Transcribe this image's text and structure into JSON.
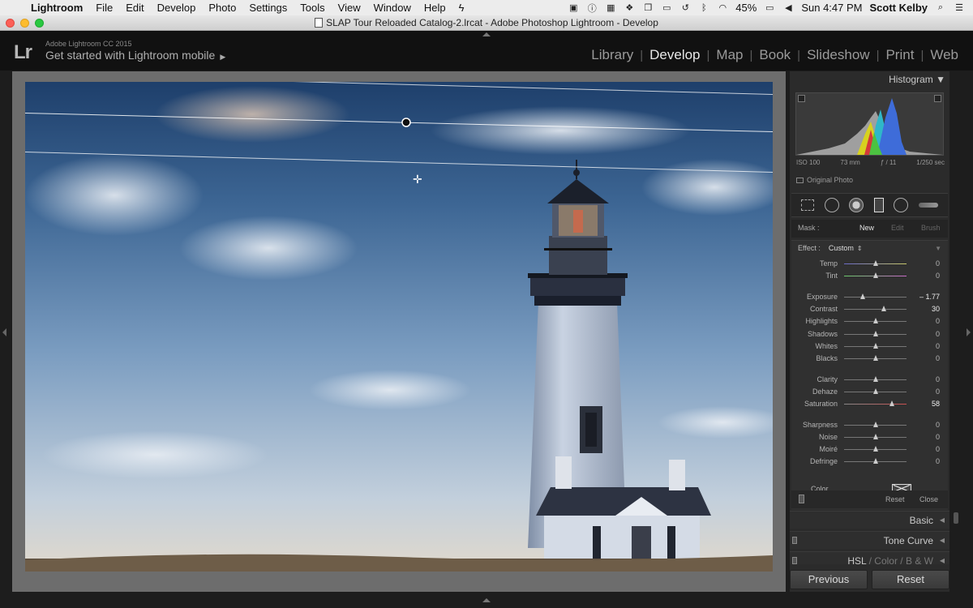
{
  "menubar": {
    "app": "Lightroom",
    "items": [
      "File",
      "Edit",
      "Develop",
      "Photo",
      "Settings",
      "Tools",
      "View",
      "Window",
      "Help"
    ],
    "battery": "45%",
    "clock": "Sun 4:47 PM",
    "user": "Scott Kelby"
  },
  "window": {
    "title": "SLAP Tour Reloaded Catalog-2.lrcat - Adobe Photoshop Lightroom - Develop"
  },
  "identity": {
    "logo": "Lr",
    "product": "Adobe Lightroom CC 2015",
    "mobile": "Get started with Lightroom mobile"
  },
  "modules": [
    "Library",
    "Develop",
    "Map",
    "Book",
    "Slideshow",
    "Print",
    "Web"
  ],
  "active_module": "Develop",
  "histogram": {
    "title": "Histogram",
    "iso": "ISO 100",
    "focal": "73 mm",
    "aperture": "ƒ / 11",
    "shutter": "1/250 sec",
    "original_photo": "Original Photo"
  },
  "mask": {
    "label": "Mask :",
    "new": "New",
    "edit": "Edit",
    "brush": "Brush"
  },
  "effect": {
    "label": "Effect :",
    "value": "Custom",
    "sliders": [
      {
        "name": "Temp",
        "value": "0",
        "pos": 0.5
      },
      {
        "name": "Tint",
        "value": "0",
        "pos": 0.5
      },
      {
        "name": "Exposure",
        "value": "– 1.77",
        "pos": 0.3
      },
      {
        "name": "Contrast",
        "value": "30",
        "pos": 0.63
      },
      {
        "name": "Highlights",
        "value": "0",
        "pos": 0.5
      },
      {
        "name": "Shadows",
        "value": "0",
        "pos": 0.5
      },
      {
        "name": "Whites",
        "value": "0",
        "pos": 0.5
      },
      {
        "name": "Blacks",
        "value": "0",
        "pos": 0.5
      },
      {
        "name": "Clarity",
        "value": "0",
        "pos": 0.5
      },
      {
        "name": "Dehaze",
        "value": "0",
        "pos": 0.5
      },
      {
        "name": "Saturation",
        "value": "58",
        "pos": 0.77
      },
      {
        "name": "Sharpness",
        "value": "0",
        "pos": 0.5
      },
      {
        "name": "Noise",
        "value": "0",
        "pos": 0.5
      },
      {
        "name": "Moiré",
        "value": "0",
        "pos": 0.5
      },
      {
        "name": "Defringe",
        "value": "0",
        "pos": 0.5
      }
    ],
    "color_label": "Color",
    "reset": "Reset",
    "close": "Close"
  },
  "panels": {
    "basic": "Basic",
    "tone_curve": "Tone Curve",
    "hsl": "HSL",
    "color": "Color",
    "bw": "B & W"
  },
  "buttons": {
    "previous": "Previous",
    "reset": "Reset"
  }
}
